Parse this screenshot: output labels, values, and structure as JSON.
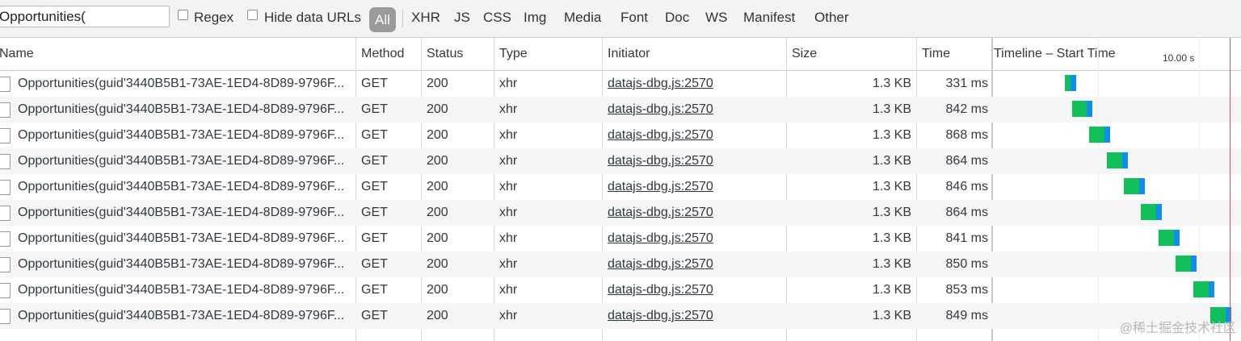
{
  "filter": {
    "value": "Opportunities(",
    "regex_label": "Regex",
    "hide_data_urls_label": "Hide data URLs",
    "types": [
      "All",
      "XHR",
      "JS",
      "CSS",
      "Img",
      "Media",
      "Font",
      "Doc",
      "WS",
      "Manifest",
      "Other"
    ],
    "active_type": "All"
  },
  "columns": {
    "name": "Name",
    "method": "Method",
    "status": "Status",
    "type": "Type",
    "initiator": "Initiator",
    "size": "Size",
    "time": "Time",
    "timeline": "Timeline – Start Time",
    "timeline_tick": "10.00 s"
  },
  "requests": [
    {
      "name": "Opportunities(guid'3440B5B1-73AE-1ED4-8D89-9796F...",
      "method": "GET",
      "status": "200",
      "type": "xhr",
      "initiator": "datajs-dbg.js:2570",
      "size": "1.3 KB",
      "time": "331 ms"
    },
    {
      "name": "Opportunities(guid'3440B5B1-73AE-1ED4-8D89-9796F...",
      "method": "GET",
      "status": "200",
      "type": "xhr",
      "initiator": "datajs-dbg.js:2570",
      "size": "1.3 KB",
      "time": "842 ms"
    },
    {
      "name": "Opportunities(guid'3440B5B1-73AE-1ED4-8D89-9796F...",
      "method": "GET",
      "status": "200",
      "type": "xhr",
      "initiator": "datajs-dbg.js:2570",
      "size": "1.3 KB",
      "time": "868 ms"
    },
    {
      "name": "Opportunities(guid'3440B5B1-73AE-1ED4-8D89-9796F...",
      "method": "GET",
      "status": "200",
      "type": "xhr",
      "initiator": "datajs-dbg.js:2570",
      "size": "1.3 KB",
      "time": "864 ms"
    },
    {
      "name": "Opportunities(guid'3440B5B1-73AE-1ED4-8D89-9796F...",
      "method": "GET",
      "status": "200",
      "type": "xhr",
      "initiator": "datajs-dbg.js:2570",
      "size": "1.3 KB",
      "time": "846 ms"
    },
    {
      "name": "Opportunities(guid'3440B5B1-73AE-1ED4-8D89-9796F...",
      "method": "GET",
      "status": "200",
      "type": "xhr",
      "initiator": "datajs-dbg.js:2570",
      "size": "1.3 KB",
      "time": "864 ms"
    },
    {
      "name": "Opportunities(guid'3440B5B1-73AE-1ED4-8D89-9796F...",
      "method": "GET",
      "status": "200",
      "type": "xhr",
      "initiator": "datajs-dbg.js:2570",
      "size": "1.3 KB",
      "time": "841 ms"
    },
    {
      "name": "Opportunities(guid'3440B5B1-73AE-1ED4-8D89-9796F...",
      "method": "GET",
      "status": "200",
      "type": "xhr",
      "initiator": "datajs-dbg.js:2570",
      "size": "1.3 KB",
      "time": "850 ms"
    },
    {
      "name": "Opportunities(guid'3440B5B1-73AE-1ED4-8D89-9796F...",
      "method": "GET",
      "status": "200",
      "type": "xhr",
      "initiator": "datajs-dbg.js:2570",
      "size": "1.3 KB",
      "time": "853 ms"
    },
    {
      "name": "Opportunities(guid'3440B5B1-73AE-1ED4-8D89-9796F...",
      "method": "GET",
      "status": "200",
      "type": "xhr",
      "initiator": "datajs-dbg.js:2570",
      "size": "1.3 KB",
      "time": "849 ms"
    }
  ],
  "watermark": "@稀土掘金技术社区",
  "colors": {
    "waterfall_receive": "#12c05a",
    "waterfall_download": "#0e8ff0",
    "load_event_line": "#d94d4d",
    "active_filter_pill": "#9a9a9a"
  }
}
